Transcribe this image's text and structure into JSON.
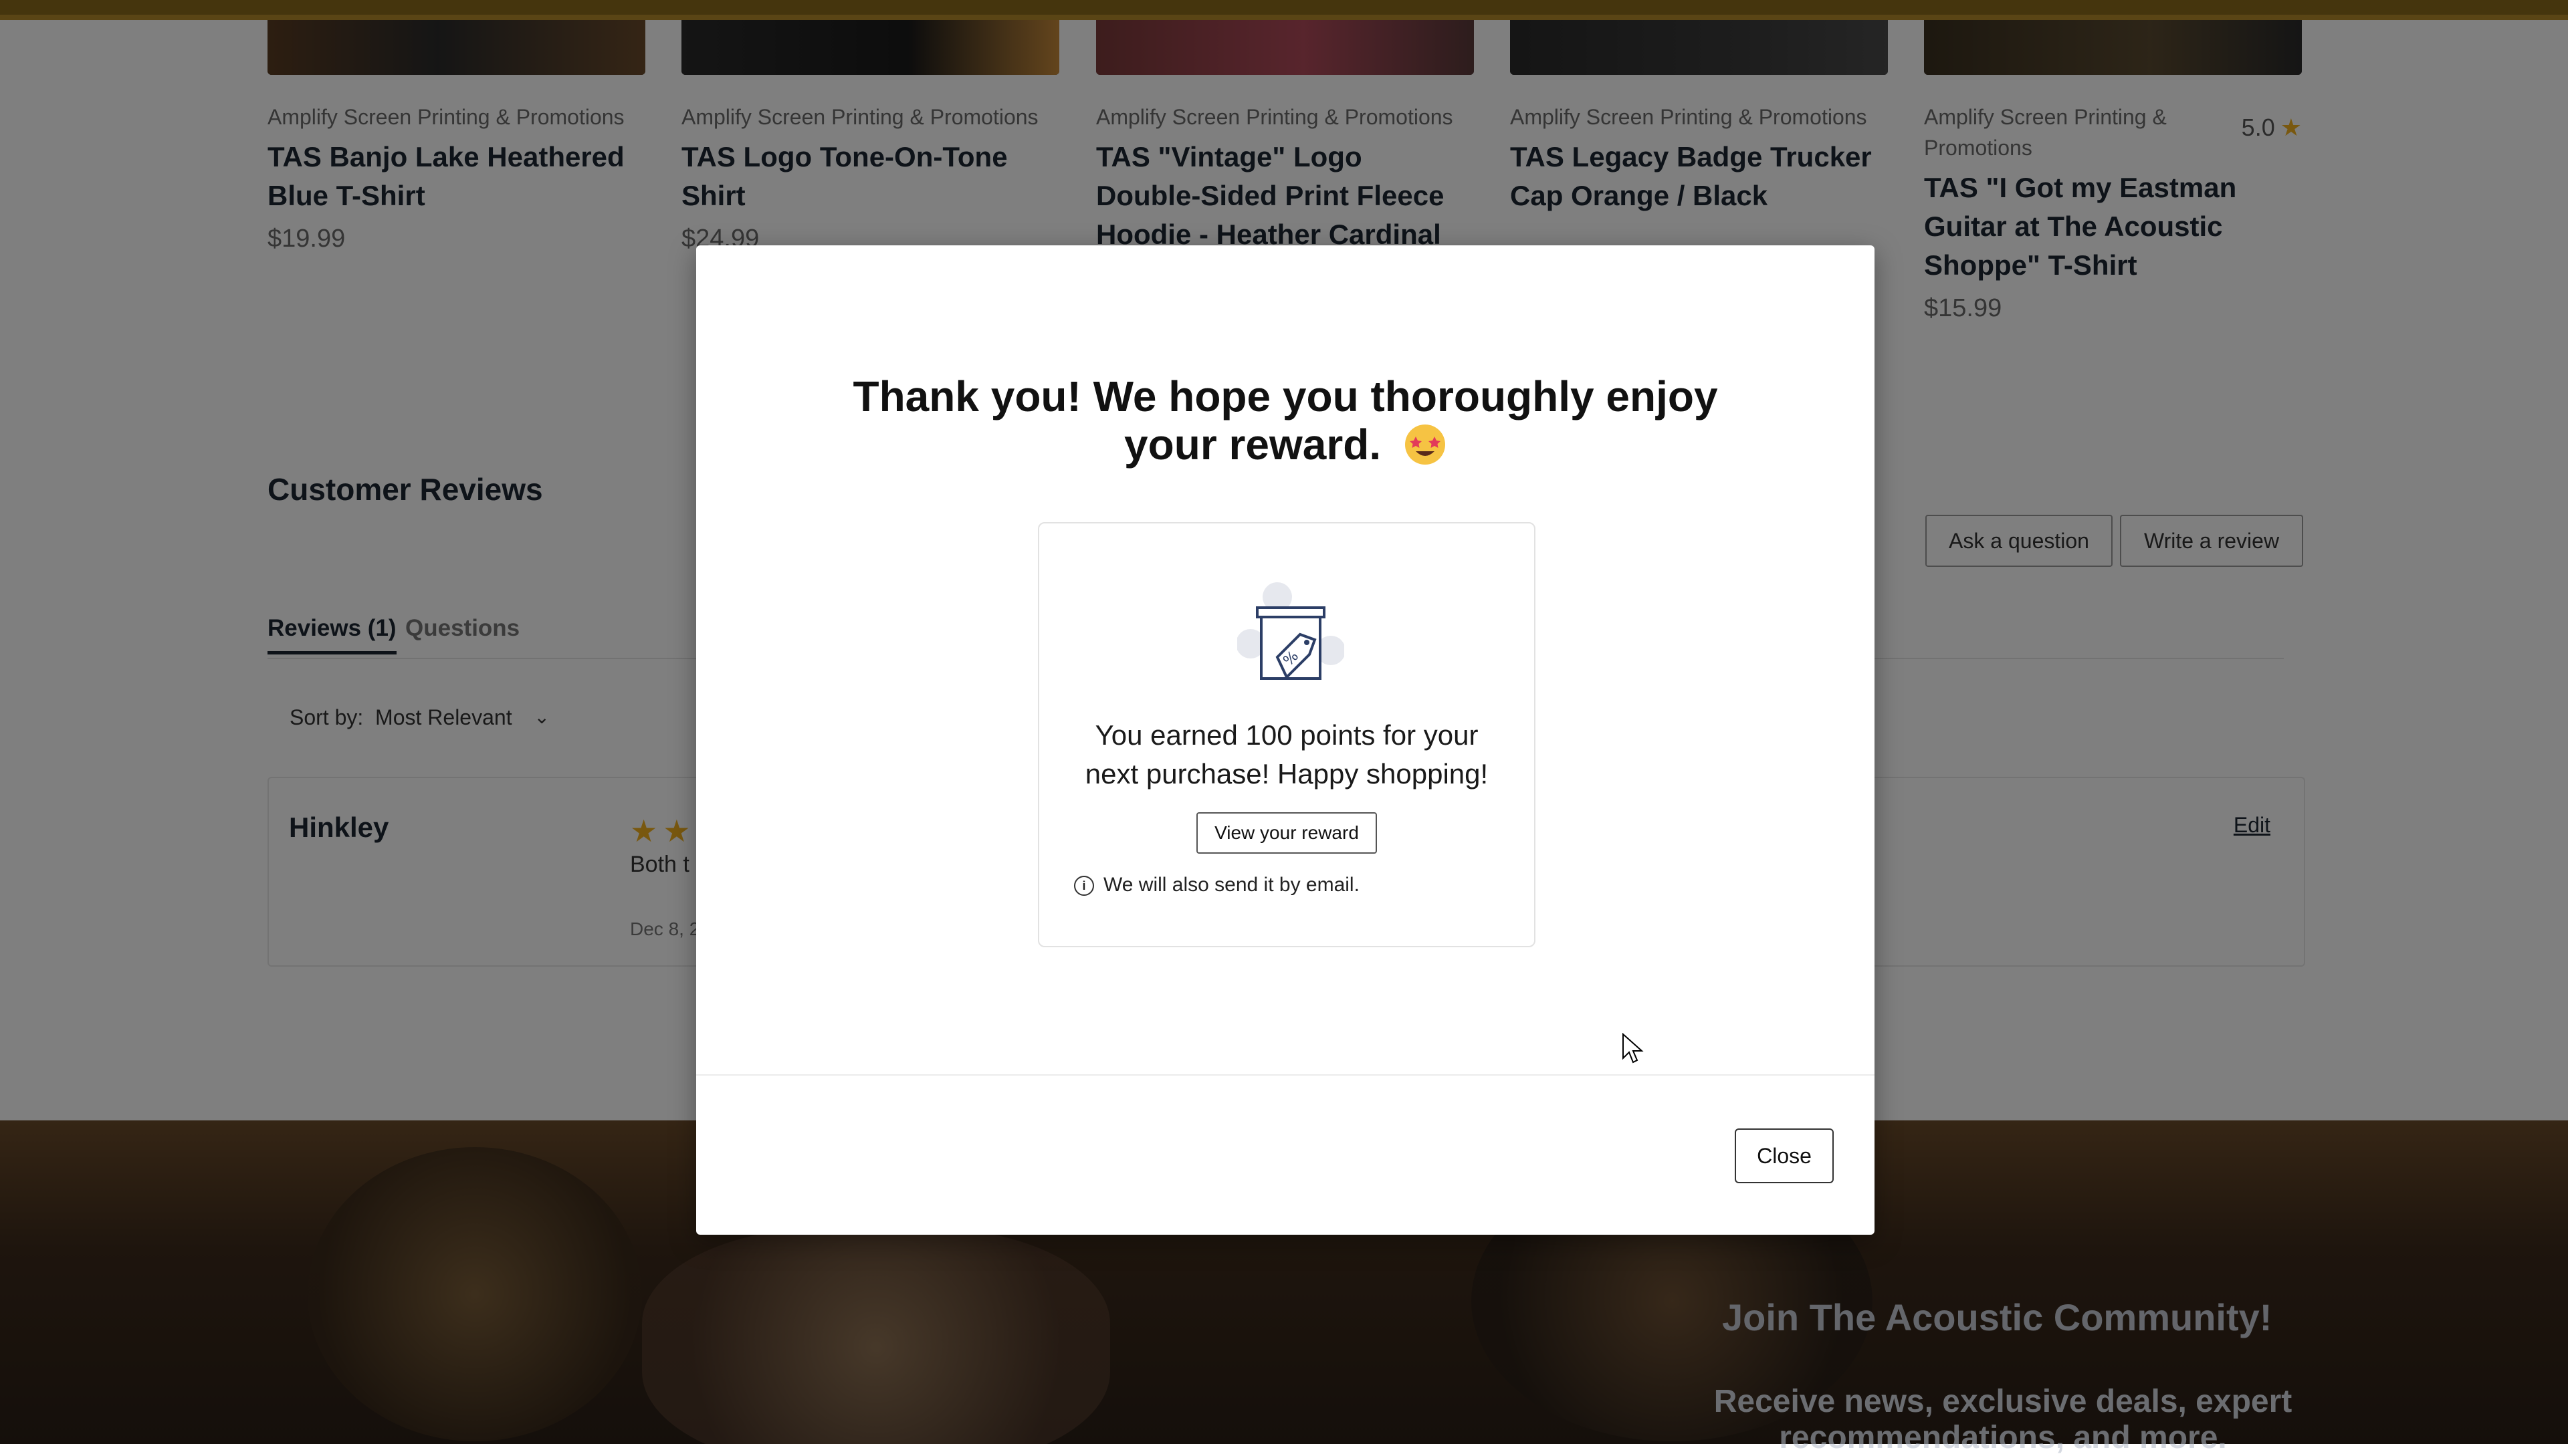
{
  "products": [
    {
      "vendor": "Amplify Screen Printing & Promotions",
      "title": "TAS Banjo Lake Heathered Blue T-Shirt",
      "price": "$19.99",
      "rating": ""
    },
    {
      "vendor": "Amplify Screen Printing & Promotions",
      "title": "TAS Logo Tone-On-Tone Shirt",
      "price": "$24.99",
      "rating": ""
    },
    {
      "vendor": "Amplify Screen Printing & Promotions",
      "title": "TAS \"Vintage\" Logo Double-Sided Print Fleece Hoodie - Heather Cardinal",
      "price": "",
      "rating": ""
    },
    {
      "vendor": "Amplify Screen Printing & Promotions",
      "title": "TAS Legacy Badge Trucker Cap Orange / Black",
      "price": "",
      "rating": ""
    },
    {
      "vendor": "Amplify Screen Printing & Promotions",
      "title": "TAS \"I Got my Eastman Guitar at The Acoustic Shoppe\" T-Shirt",
      "price": "$15.99",
      "rating": "5.0"
    }
  ],
  "reviews_section": {
    "title": "Customer Reviews",
    "ask_question": "Ask a question",
    "write_review": "Write a review",
    "tab_reviews": "Reviews (1)",
    "tab_questions": "Questions",
    "sort_label": "Sort by:",
    "sort_value": "Most Relevant",
    "review": {
      "author": "Hinkley",
      "text": "Both t",
      "date": "Dec 8, 2",
      "edit": "Edit"
    }
  },
  "footer": {
    "join": "Join The Acoustic Community!",
    "receive": "Receive news, exclusive deals, expert recommendations, and more."
  },
  "modal": {
    "title_line1": "Thank you! We hope you thoroughly enjoy",
    "title_line2": "your reward.",
    "earned_line1": "You earned 100 points for your",
    "earned_line2": "next purchase! Happy shopping!",
    "view_button": "View your reward",
    "email_note": "We will also send it by email.",
    "close_button": "Close"
  },
  "colors": {
    "accent_star": "#f2b01e",
    "overlay": "rgba(0,0,0,0.5)",
    "top_bar": "#8a6a1a"
  }
}
